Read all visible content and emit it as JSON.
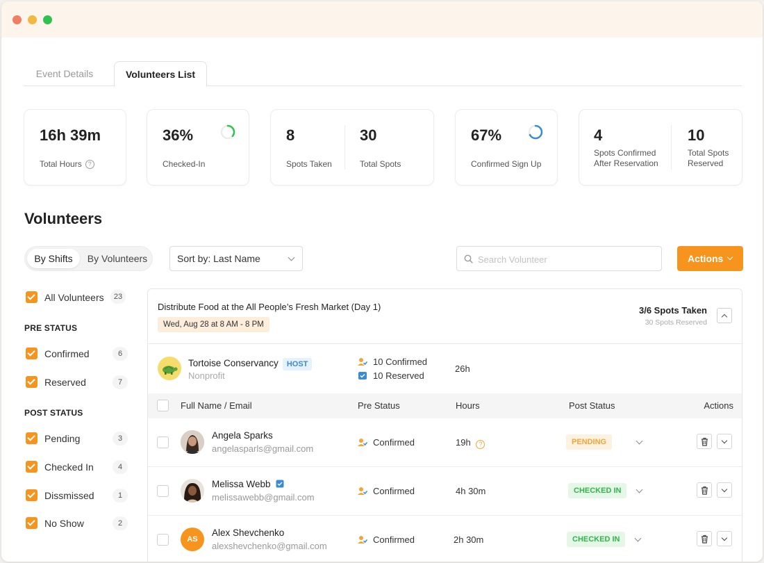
{
  "tabs": [
    {
      "label": "Event Details"
    },
    {
      "label": "Volunteers List"
    }
  ],
  "stats": {
    "total_hours": {
      "value": "16h 39m",
      "label": "Total Hours"
    },
    "checked_in": {
      "value": "36%",
      "label": "Checked-In",
      "ring_fraction": 0.36,
      "ring_color": "#2fc24e"
    },
    "spots_taken": {
      "value": "8",
      "label": "Spots Taken"
    },
    "total_spots": {
      "value": "30",
      "label": "Total Spots"
    },
    "confirmed_signup": {
      "value": "67%",
      "label": "Confirmed Sign Up",
      "ring_fraction": 0.67,
      "ring_color": "#3b8ad6"
    },
    "spots_confirmed": {
      "value": "4",
      "label_line1": "Spots Confirmed",
      "label_line2": "After Reservation"
    },
    "total_reserved": {
      "value": "10",
      "label_line1": "Total Spots",
      "label_line2": "Reserved"
    }
  },
  "heading": "Volunteers",
  "toggle": {
    "by_shifts": "By Shifts",
    "by_volunteers": "By Volunteers"
  },
  "sort": {
    "label": "Sort by: Last Name"
  },
  "search": {
    "placeholder": "Search Volunteer"
  },
  "actions_label": "Actions",
  "filters": {
    "all": {
      "label": "All Volunteers",
      "count": "23"
    },
    "pre_status_title": "PRE STATUS",
    "pre": [
      {
        "label": "Confirmed",
        "count": "6"
      },
      {
        "label": "Reserved",
        "count": "7"
      }
    ],
    "post_status_title": "POST STATUS",
    "post": [
      {
        "label": "Pending",
        "count": "3"
      },
      {
        "label": "Checked In",
        "count": "4"
      },
      {
        "label": "Dissmissed",
        "count": "1"
      },
      {
        "label": "No Show",
        "count": "2"
      }
    ]
  },
  "shift": {
    "title": "Distribute Food at the All People’s Fresh Market (Day 1)",
    "date": "Wed, Aug 28 at 8 AM - 8 PM",
    "spots": "3/6 Spots Taken",
    "spots_reserved": "30 Spots Reserved"
  },
  "host": {
    "name": "Tortoise Conservancy",
    "tag": "HOST",
    "type": "Nonprofit",
    "confirmed": "10 Confirmed",
    "reserved": "10 Reserved",
    "hours": "26h"
  },
  "table": {
    "headers": {
      "name": "Full Name / Email",
      "pre": "Pre Status",
      "hours": "Hours",
      "post": "Post Status",
      "actions": "Actions"
    },
    "rows": [
      {
        "name": "Angela Sparks",
        "email": "angelasparls@gmail.com",
        "pre": "Confirmed",
        "hours": "19h",
        "post": "PENDING",
        "initials": ""
      },
      {
        "name": "Melissa Webb",
        "email": "melissawebb@gmail.com",
        "pre": "Confirmed",
        "hours": "4h 30m",
        "post": "CHECKED IN",
        "initials": ""
      },
      {
        "name": "Alex Shevchenko",
        "email": "alexshevchenko@gmail.com",
        "pre": "Confirmed",
        "hours": "2h 30m",
        "post": "CHECKED IN",
        "initials": "AS"
      }
    ]
  },
  "colors": {
    "accent": "#f7941d",
    "confirmed_icon": "#f2a53a",
    "reserved_icon": "#3b8ad6",
    "checked_green": "#31b44b"
  }
}
